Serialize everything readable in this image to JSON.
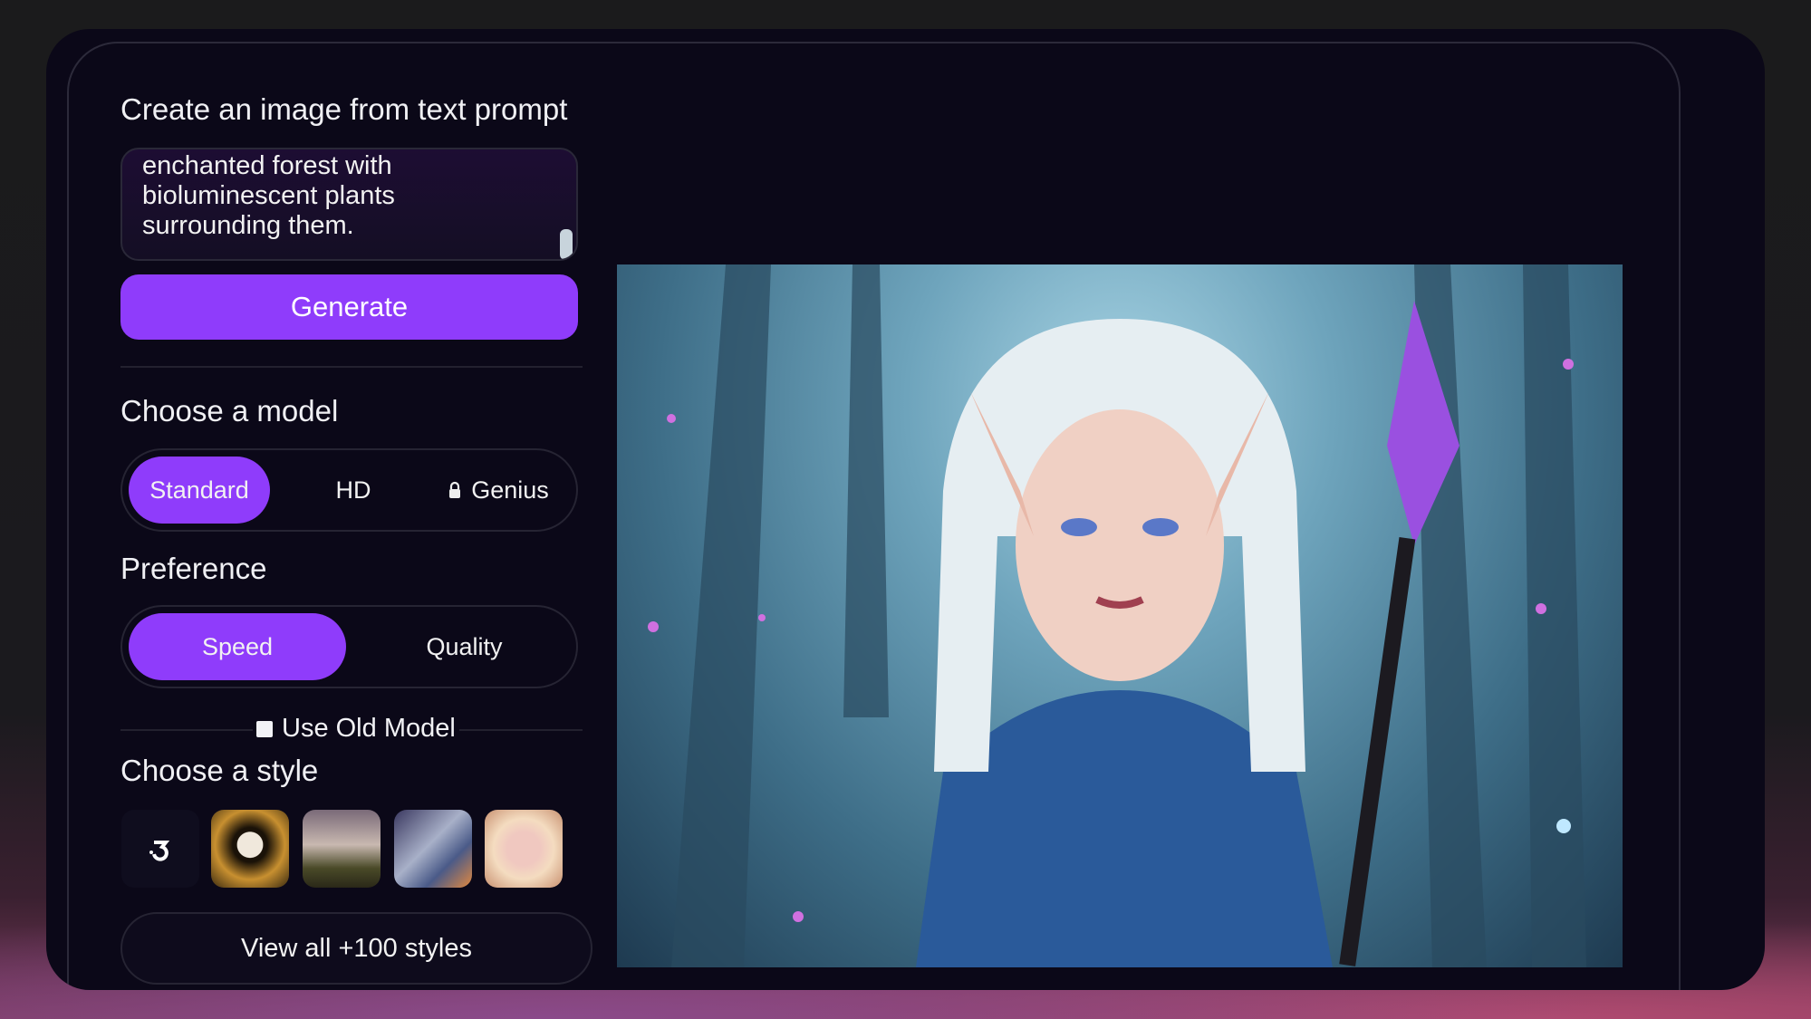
{
  "prompt_section": {
    "title": "Create an image from text prompt",
    "prompt_value": "enchanted forest with bioluminescent plants surrounding them.",
    "generate_label": "Generate"
  },
  "model_section": {
    "title": "Choose a model",
    "options": [
      {
        "label": "Standard",
        "selected": true
      },
      {
        "label": "HD",
        "selected": false
      },
      {
        "label": "Genius",
        "selected": false,
        "icon": "lock-icon"
      }
    ]
  },
  "preference_section": {
    "title": "Preference",
    "options": [
      {
        "label": "Speed",
        "selected": true
      },
      {
        "label": "Quality",
        "selected": false
      }
    ],
    "old_model_label": "Use Old Model",
    "old_model_checked": false
  },
  "style_section": {
    "title": "Choose a style",
    "styles": [
      "none-icon",
      "panda",
      "forest",
      "robot",
      "anime-girl"
    ],
    "view_all_label": "View all +100 styles"
  },
  "colors": {
    "accent": "#8f3cfb",
    "background": "#0b0818"
  }
}
